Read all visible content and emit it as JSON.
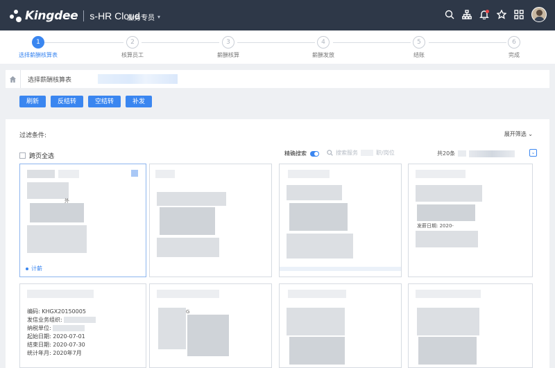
{
  "header": {
    "brand": "Kingdee",
    "product": "s-HR Cloud",
    "role_label": "业务专员",
    "icons": [
      "search-icon",
      "org-tree-icon",
      "bell-icon",
      "star-icon",
      "apps-grid-icon"
    ],
    "brand_color": "#2e3848",
    "accent_color": "#3a86f0"
  },
  "stepper": {
    "steps": [
      {
        "num": "1",
        "label": "选择薪酬核算表",
        "active": true
      },
      {
        "num": "2",
        "label": "核算员工",
        "active": false
      },
      {
        "num": "3",
        "label": "薪酬核算",
        "active": false
      },
      {
        "num": "4",
        "label": "薪酬发放",
        "active": false
      },
      {
        "num": "5",
        "label": "结账",
        "active": false
      },
      {
        "num": "6",
        "label": "完成",
        "active": false
      }
    ]
  },
  "breadcrumb": {
    "current": "选择薪酬核算表"
  },
  "toolbar": {
    "refresh": "刷新",
    "reverse_close": "反结转",
    "empty_close": "空结转",
    "reissue": "补发"
  },
  "filter": {
    "title": "过滤条件:",
    "expand": "展开筛选",
    "select_all": "跨页全选",
    "exact_search": "精确搜索",
    "search_placeholder": "搜索服务",
    "search_placeholder_tail": "职/岗位",
    "total_prefix": "共20条"
  },
  "cards": {
    "first_footer": "计薪",
    "detail": {
      "code_label": "编码:",
      "code_value": "KHGX20150005",
      "org_label": "发信业务组织:",
      "unit_label": "纳税单位:",
      "start_label": "起始日期:",
      "start_value": "2020-07-01",
      "end_label": "结束日期:",
      "end_value": "2020-07-30",
      "period_label": "统计年月:",
      "period_value": "2020年7月"
    },
    "fragment_texts": {
      "c1": "外",
      "c4": "发薪日期: 2020-",
      "c6": "G"
    }
  }
}
